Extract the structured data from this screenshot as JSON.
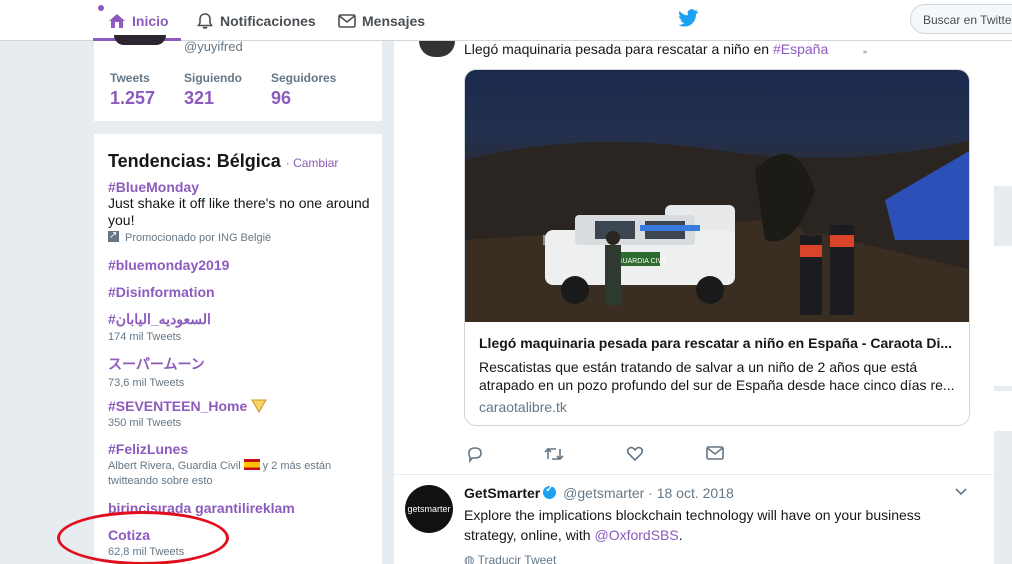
{
  "nav": {
    "home": "Inicio",
    "notifications": "Notificaciones",
    "messages": "Mensajes",
    "search_placeholder": "Buscar en Twitter",
    "colors": {
      "accent": "#8c5bbd",
      "twitter_blue": "#1da1f2"
    }
  },
  "profile": {
    "handle": "@yuyifred",
    "stats": [
      {
        "label": "Tweets",
        "value": "1.257"
      },
      {
        "label": "Siguiendo",
        "value": "321"
      },
      {
        "label": "Seguidores",
        "value": "96"
      }
    ]
  },
  "trends": {
    "title": "Tendencias: Bélgica",
    "change": "· Cambiar",
    "items": [
      {
        "name": "#BlueMonday",
        "desc": "Just shake it off like there's no one around you!",
        "meta": "Promocionado por ING België"
      },
      {
        "name": "#bluemonday2019"
      },
      {
        "name": "#Disinformation"
      },
      {
        "name": "#السعوديه_اليابان",
        "meta": "174 mil Tweets"
      },
      {
        "name": "スーパームーン",
        "meta": "73,6 mil Tweets"
      },
      {
        "name": "#SEVENTEEN_Home",
        "meta": "350 mil Tweets"
      },
      {
        "name": "#FelizLunes",
        "meta_a": "Albert Rivera, Guardia Civil",
        "meta_b": "y 2 más están twitteando sobre esto"
      },
      {
        "name": "birincisırada garantilireklam"
      },
      {
        "name": "Cotiza",
        "meta": "62,8 mil Tweets"
      }
    ]
  },
  "timeline": {
    "tweet1": {
      "text": "Llegó maquinaria pesada para rescatar a niño en ",
      "hashtag": "#España",
      "card": {
        "title": "Llegó maquinaria pesada para rescatar a niño en España - Caraota Di...",
        "desc": "Rescatistas que están tratando de salvar a un niño de 2 años que está atrapado en un pozo profundo del sur de España desde hace cinco días re...",
        "domain": "caraotalibre.tk",
        "image_caption_vehicle": "GUARDIA CIVIL"
      }
    },
    "tweet2": {
      "name": "GetSmarter",
      "handle": "@getsmarter",
      "date": "· 18 oct. 2018",
      "body": "Explore the implications blockchain technology will have on your business strategy, online, with ",
      "mention": "@OxfordSBS",
      "body_end": ".",
      "translate": "Traducir Tweet",
      "avatar_text": "getsmarter"
    }
  }
}
